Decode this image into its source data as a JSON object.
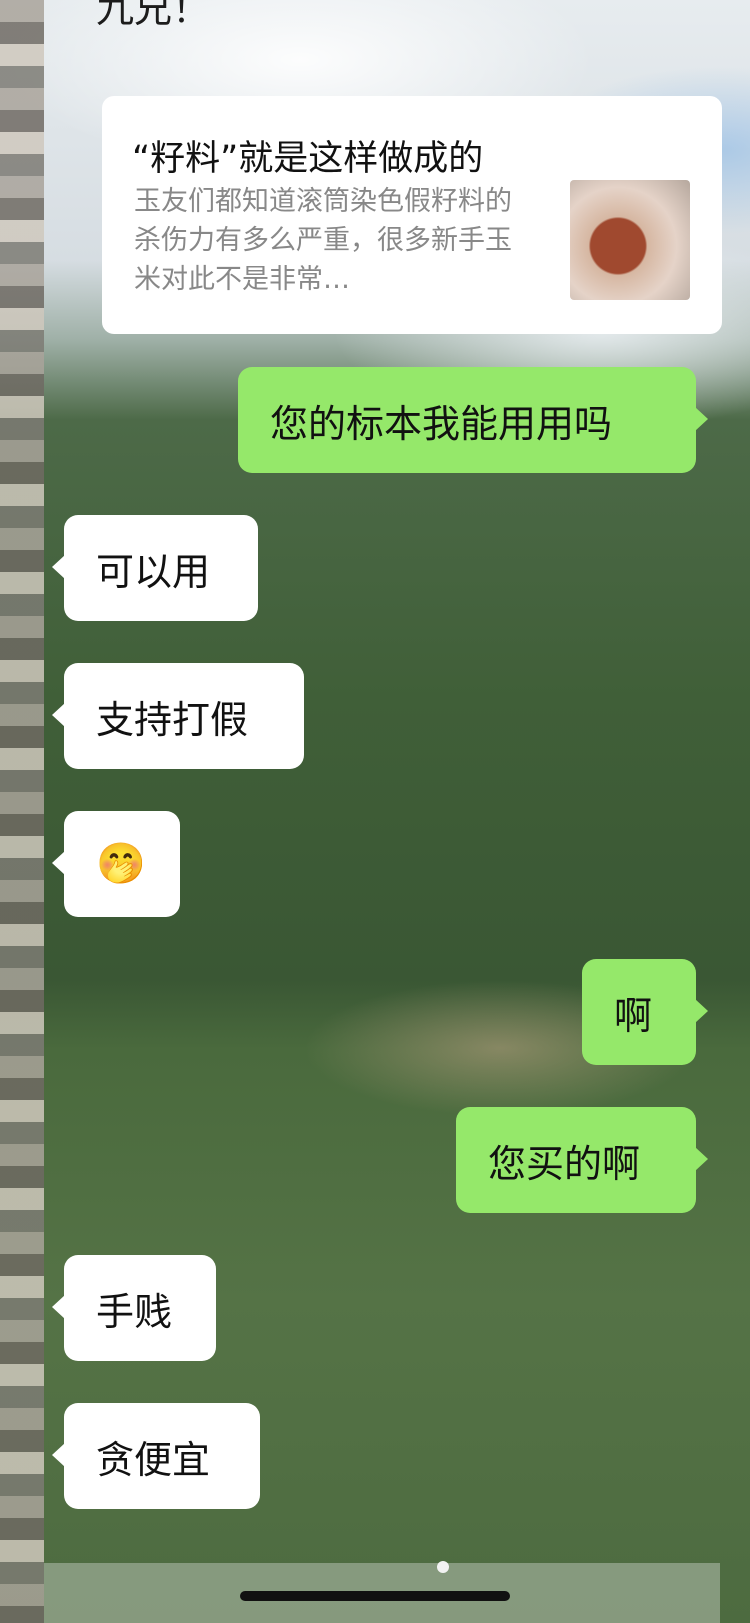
{
  "chat": {
    "top_fragment": "九兄！",
    "link_card": {
      "title": "“籽料”就是这样做成的",
      "description": "玉友们都知道滚筒染色假籽料的杀伤力有多么严重，很多新手玉米对此不是非常…"
    },
    "messages": [
      {
        "side": "right",
        "text": "您的标本我能用用吗"
      },
      {
        "side": "left",
        "text": "可以用"
      },
      {
        "side": "left",
        "text": "支持打假"
      },
      {
        "side": "left",
        "text": "🤭"
      },
      {
        "side": "right",
        "text": "啊"
      },
      {
        "side": "right",
        "text": "您买的啊"
      },
      {
        "side": "left",
        "text": "手贱"
      },
      {
        "side": "left",
        "text": "贪便宜"
      }
    ]
  },
  "colors": {
    "sent_bubble": "#95e86a",
    "received_bubble": "#ffffff"
  },
  "icons": {
    "emoji": "face-with-hand-over-mouth-icon",
    "thumbnail": "jade-stone-thumbnail"
  }
}
